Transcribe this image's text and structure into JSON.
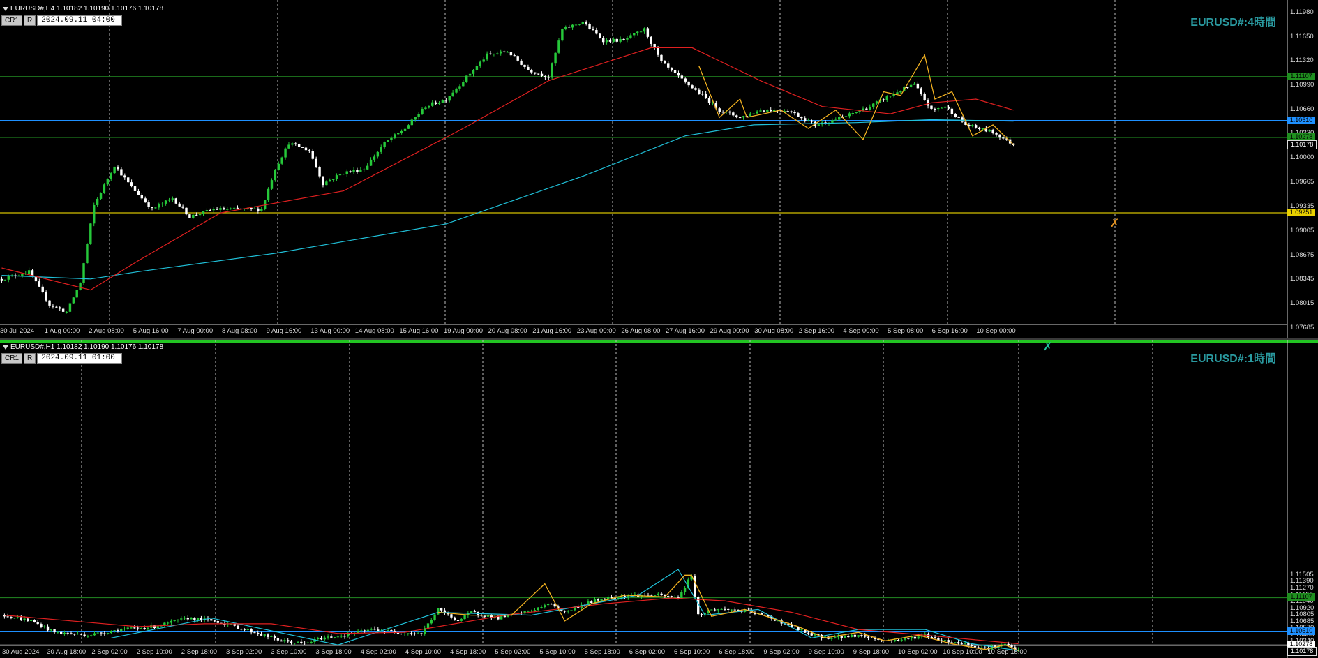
{
  "colors": {
    "background": "#000000",
    "bull": "#26c83a",
    "bear": "#ffffff",
    "ma_fast": "#e02020",
    "ma_slow": "#20c0d8",
    "zigzag": "#f0b020",
    "green_line": "#1e7a1e",
    "blue_line": "#1e90ff",
    "yellow_line": "#d4c000"
  },
  "pane1": {
    "header": "EURUSD#,H4  1.10182 1.10190 1.10176 1.10178",
    "toolbar": {
      "btn1": "CR1",
      "btn2": "R",
      "date": "2024.09.11  04:00"
    },
    "watermark": "EURUSD#:4時間",
    "price_ticks": [
      "1.11980",
      "1.11650",
      "1.11320",
      "1.10990",
      "1.10660",
      "1.10330",
      "1.10000",
      "1.09665",
      "1.09335",
      "1.09005",
      "1.08675",
      "1.08345",
      "1.08015",
      "1.07685"
    ],
    "price_labels": [
      {
        "text": "1.11107",
        "kind": "green"
      },
      {
        "text": "1.10510",
        "kind": "blue"
      },
      {
        "text": "1.10278",
        "kind": "green"
      },
      {
        "text": "1.10178",
        "kind": "current"
      },
      {
        "text": "1.09251",
        "kind": "yellow"
      }
    ],
    "time_labels": [
      "30 Jul 2024",
      "1 Aug 00:00",
      "2 Aug 08:00",
      "5 Aug 16:00",
      "7 Aug 00:00",
      "8 Aug 08:00",
      "9 Aug 16:00",
      "13 Aug 00:00",
      "14 Aug 08:00",
      "15 Aug 16:00",
      "19 Aug 00:00",
      "20 Aug 08:00",
      "21 Aug 16:00",
      "23 Aug 00:00",
      "26 Aug 08:00",
      "27 Aug 16:00",
      "29 Aug 00:00",
      "30 Aug 08:00",
      "2 Sep 16:00",
      "4 Sep 00:00",
      "5 Sep 08:00",
      "6 Sep 16:00",
      "10 Sep 00:00"
    ]
  },
  "pane2": {
    "header": "EURUSD#,H1  1.10182 1.10190 1.10176 1.10178",
    "toolbar": {
      "btn1": "CR1",
      "btn2": "R",
      "date": "2024.09.11  01:00"
    },
    "watermark": "EURUSD#:1時間",
    "price_ticks": [
      "1.11505",
      "1.11390",
      "1.11270",
      "1.11155",
      "1.11040",
      "1.10920",
      "1.10805",
      "1.10685",
      "1.10570",
      "1.10455",
      "1.10340",
      "1.10225",
      "1.10110"
    ],
    "price_labels": [
      {
        "text": "1.11107",
        "kind": "green"
      },
      {
        "text": "1.10510",
        "kind": "blue"
      },
      {
        "text": "1.10278",
        "kind": "white"
      },
      {
        "text": "1.10178",
        "kind": "current"
      }
    ],
    "time_labels": [
      "30 Aug 2024",
      "30 Aug 18:00",
      "2 Sep 02:00",
      "2 Sep 10:00",
      "2 Sep 18:00",
      "3 Sep 02:00",
      "3 Sep 10:00",
      "3 Sep 18:00",
      "4 Sep 02:00",
      "4 Sep 10:00",
      "4 Sep 18:00",
      "5 Sep 02:00",
      "5 Sep 10:00",
      "5 Sep 18:00",
      "6 Sep 02:00",
      "6 Sep 10:00",
      "6 Sep 18:00",
      "9 Sep 02:00",
      "9 Sep 10:00",
      "9 Sep 18:00",
      "10 Sep 02:00",
      "10 Sep 10:00",
      "10 Sep 18:00"
    ]
  },
  "chart_data": [
    {
      "type": "candlestick",
      "title": "EURUSD#,H4",
      "ylim": [
        1.0755,
        1.1215
      ],
      "horizontal_levels": [
        {
          "price": 1.11107,
          "color": "green"
        },
        {
          "price": 1.1051,
          "color": "blue"
        },
        {
          "price": 1.10278,
          "color": "green"
        },
        {
          "price": 1.09251,
          "color": "yellow"
        }
      ],
      "anchors": [
        [
          0,
          1.0835
        ],
        [
          8,
          1.0845
        ],
        [
          14,
          1.08
        ],
        [
          19,
          1.079
        ],
        [
          23,
          1.083
        ],
        [
          27,
          1.0935
        ],
        [
          33,
          1.099
        ],
        [
          38,
          1.096
        ],
        [
          44,
          1.093
        ],
        [
          50,
          1.0945
        ],
        [
          55,
          1.092
        ],
        [
          62,
          1.093
        ],
        [
          70,
          1.093
        ],
        [
          76,
          1.093
        ],
        [
          80,
          1.0985
        ],
        [
          84,
          1.102
        ],
        [
          90,
          1.101
        ],
        [
          94,
          1.0965
        ],
        [
          100,
          1.098
        ],
        [
          106,
          1.0985
        ],
        [
          112,
          1.102
        ],
        [
          118,
          1.104
        ],
        [
          124,
          1.107
        ],
        [
          130,
          1.108
        ],
        [
          136,
          1.111
        ],
        [
          142,
          1.114
        ],
        [
          148,
          1.1145
        ],
        [
          154,
          1.112
        ],
        [
          160,
          1.111
        ],
        [
          164,
          1.1175
        ],
        [
          170,
          1.1185
        ],
        [
          176,
          1.116
        ],
        [
          182,
          1.116
        ],
        [
          188,
          1.1175
        ],
        [
          193,
          1.113
        ],
        [
          198,
          1.111
        ],
        [
          205,
          1.1085
        ],
        [
          210,
          1.1065
        ],
        [
          216,
          1.1055
        ],
        [
          222,
          1.1065
        ],
        [
          230,
          1.1065
        ],
        [
          238,
          1.1045
        ],
        [
          246,
          1.1055
        ],
        [
          254,
          1.107
        ],
        [
          262,
          1.109
        ],
        [
          267,
          1.11
        ],
        [
          272,
          1.1065
        ],
        [
          276,
          1.107
        ],
        [
          282,
          1.1045
        ],
        [
          290,
          1.1035
        ],
        [
          296,
          1.1018
        ]
      ],
      "ma_fast": [
        [
          0,
          1.085
        ],
        [
          26,
          1.082
        ],
        [
          40,
          1.086
        ],
        [
          64,
          1.0925
        ],
        [
          100,
          1.0955
        ],
        [
          135,
          1.104
        ],
        [
          160,
          1.1105
        ],
        [
          190,
          1.115
        ],
        [
          202,
          1.115
        ],
        [
          222,
          1.1105
        ],
        [
          240,
          1.107
        ],
        [
          260,
          1.106
        ],
        [
          272,
          1.1075
        ],
        [
          285,
          1.108
        ],
        [
          296,
          1.1065
        ]
      ],
      "ma_slow": [
        [
          0,
          1.084
        ],
        [
          26,
          1.0835
        ],
        [
          40,
          1.0845
        ],
        [
          80,
          1.087
        ],
        [
          130,
          1.091
        ],
        [
          170,
          1.0975
        ],
        [
          200,
          1.103
        ],
        [
          220,
          1.1045
        ],
        [
          250,
          1.1048
        ],
        [
          272,
          1.1052
        ],
        [
          296,
          1.105
        ]
      ],
      "zigzag": [
        [
          204,
          1.1125
        ],
        [
          210,
          1.1055
        ],
        [
          216,
          1.108
        ],
        [
          218,
          1.1055
        ],
        [
          228,
          1.1065
        ],
        [
          236,
          1.104
        ],
        [
          244,
          1.1065
        ],
        [
          252,
          1.1025
        ],
        [
          258,
          1.109
        ],
        [
          263,
          1.1085
        ],
        [
          270,
          1.114
        ],
        [
          273,
          1.108
        ],
        [
          278,
          1.109
        ],
        [
          284,
          1.103
        ],
        [
          290,
          1.1045
        ],
        [
          296,
          1.1018
        ]
      ]
    },
    {
      "type": "candlestick",
      "title": "EURUSD#,H1",
      "ylim": [
        1.1005,
        1.1562
      ],
      "horizontal_levels": [
        {
          "price": 1.11107,
          "color": "green"
        },
        {
          "price": 1.1051,
          "color": "blue"
        },
        {
          "price": 1.10278,
          "color": "white"
        }
      ],
      "anchors": [
        [
          0,
          1.108
        ],
        [
          8,
          1.107
        ],
        [
          15,
          1.105
        ],
        [
          25,
          1.1045
        ],
        [
          35,
          1.1055
        ],
        [
          45,
          1.106
        ],
        [
          55,
          1.1075
        ],
        [
          63,
          1.107
        ],
        [
          68,
          1.1062
        ],
        [
          75,
          1.105
        ],
        [
          83,
          1.1035
        ],
        [
          90,
          1.103
        ],
        [
          95,
          1.104
        ],
        [
          102,
          1.1045
        ],
        [
          110,
          1.1055
        ],
        [
          118,
          1.105
        ],
        [
          125,
          1.1048
        ],
        [
          130,
          1.109
        ],
        [
          136,
          1.107
        ],
        [
          140,
          1.1085
        ],
        [
          148,
          1.1075
        ],
        [
          156,
          1.1085
        ],
        [
          164,
          1.11
        ],
        [
          168,
          1.1085
        ],
        [
          174,
          1.11
        ],
        [
          180,
          1.111
        ],
        [
          188,
          1.1115
        ],
        [
          196,
          1.1115
        ],
        [
          202,
          1.111
        ],
        [
          206,
          1.115
        ],
        [
          208,
          1.108
        ],
        [
          212,
          1.109
        ],
        [
          218,
          1.109
        ],
        [
          224,
          1.1085
        ],
        [
          230,
          1.1075
        ],
        [
          236,
          1.106
        ],
        [
          242,
          1.1045
        ],
        [
          248,
          1.104
        ],
        [
          256,
          1.1045
        ],
        [
          264,
          1.1035
        ],
        [
          270,
          1.1038
        ],
        [
          276,
          1.1045
        ],
        [
          282,
          1.1035
        ],
        [
          288,
          1.103
        ],
        [
          294,
          1.1022
        ],
        [
          300,
          1.1028
        ],
        [
          304,
          1.1018
        ]
      ],
      "ma_fast": [
        [
          0,
          1.108
        ],
        [
          20,
          1.107
        ],
        [
          40,
          1.106
        ],
        [
          60,
          1.1065
        ],
        [
          80,
          1.1065
        ],
        [
          100,
          1.1048
        ],
        [
          120,
          1.105
        ],
        [
          150,
          1.108
        ],
        [
          180,
          1.11
        ],
        [
          200,
          1.111
        ],
        [
          216,
          1.1105
        ],
        [
          236,
          1.1085
        ],
        [
          256,
          1.1055
        ],
        [
          276,
          1.1045
        ],
        [
          304,
          1.103
        ]
      ],
      "ma_slow": [
        [
          32,
          1.104
        ],
        [
          62,
          1.1075
        ],
        [
          100,
          1.1028
        ],
        [
          130,
          1.1085
        ],
        [
          158,
          1.108
        ],
        [
          190,
          1.1115
        ],
        [
          202,
          1.116
        ],
        [
          210,
          1.108
        ],
        [
          226,
          1.109
        ],
        [
          242,
          1.104
        ],
        [
          256,
          1.1055
        ],
        [
          276,
          1.1055
        ],
        [
          290,
          1.103
        ],
        [
          304,
          1.1018
        ]
      ],
      "zigzag": [
        [
          130,
          1.1085
        ],
        [
          140,
          1.108
        ],
        [
          152,
          1.108
        ],
        [
          162,
          1.1135
        ],
        [
          168,
          1.107
        ],
        [
          176,
          1.11
        ],
        [
          186,
          1.1115
        ],
        [
          198,
          1.1112
        ],
        [
          204,
          1.115
        ],
        [
          206,
          1.115
        ],
        [
          212,
          1.1078
        ],
        [
          222,
          1.109
        ],
        [
          238,
          1.106
        ],
        [
          246,
          1.104
        ],
        [
          256,
          1.105
        ],
        [
          264,
          1.1035
        ],
        [
          274,
          1.1045
        ],
        [
          284,
          1.103
        ],
        [
          294,
          1.102
        ],
        [
          300,
          1.1028
        ],
        [
          304,
          1.1018
        ]
      ]
    }
  ]
}
